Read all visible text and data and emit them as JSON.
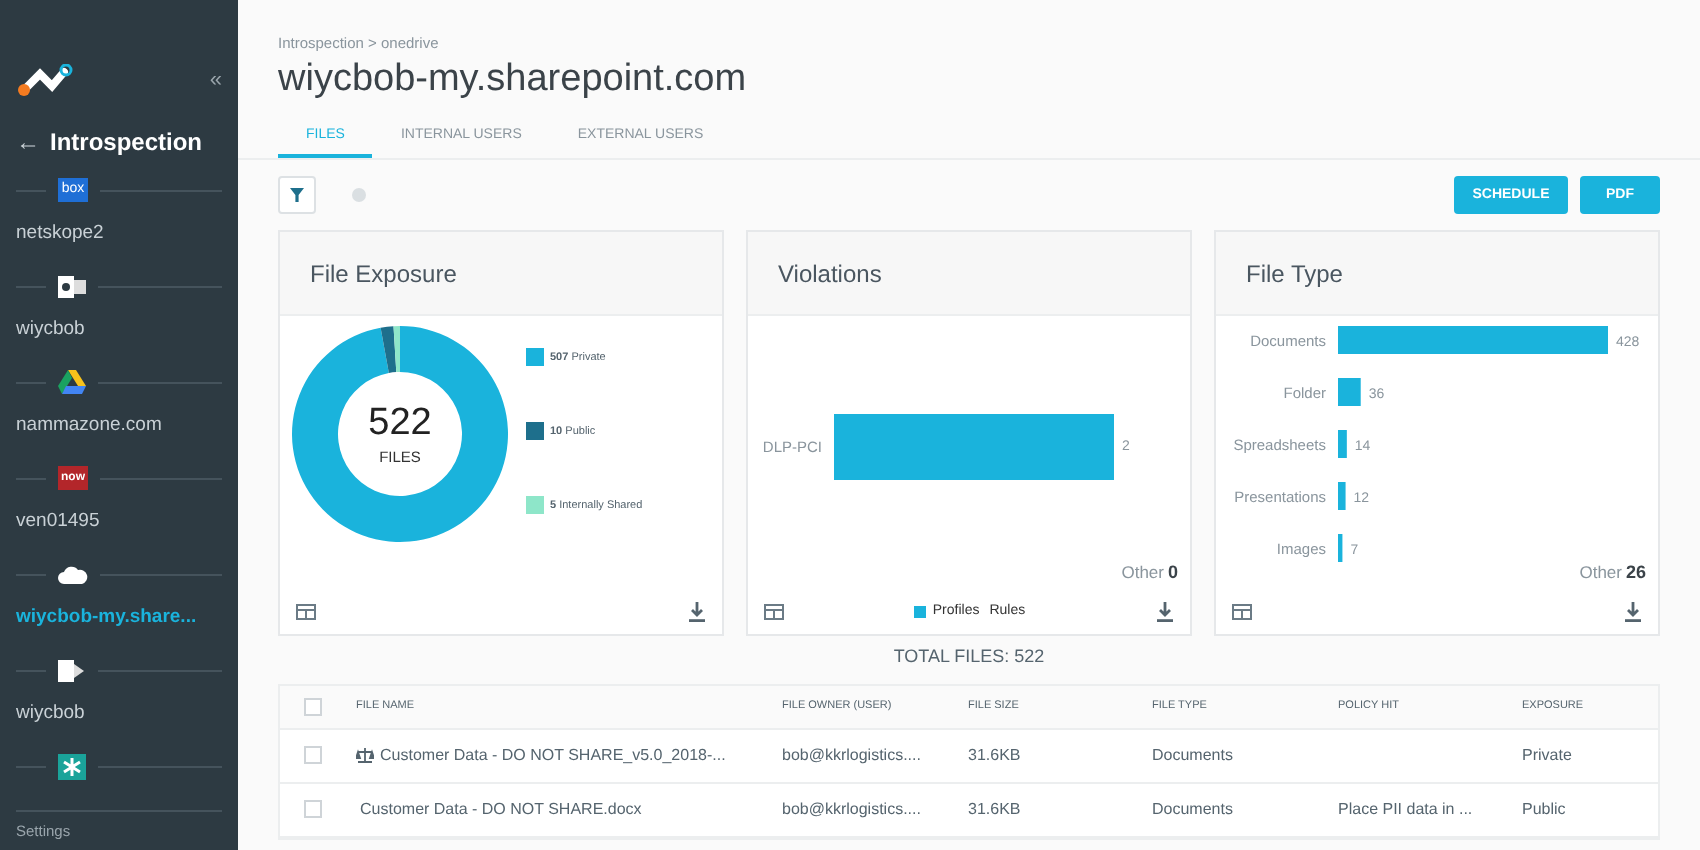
{
  "sidebar": {
    "collapse": "«",
    "back": "←",
    "title": "Introspection",
    "items": [
      {
        "kind": "box",
        "icon_text": "box",
        "label": "netskope2",
        "selected": false
      },
      {
        "kind": "outlook",
        "label": "wiycbob",
        "selected": false
      },
      {
        "kind": "drive",
        "label": "nammazone.com",
        "selected": false
      },
      {
        "kind": "now",
        "icon_text": "now",
        "label": "ven01495",
        "selected": false
      },
      {
        "kind": "cloud",
        "label": "wiycbob-my.share...",
        "selected": true
      },
      {
        "kind": "sharepoint",
        "label": "wiycbob",
        "selected": false
      },
      {
        "kind": "star"
      }
    ],
    "settings": "Settings"
  },
  "breadcrumb": "Introspection > onedrive",
  "title": "wiycbob-my.sharepoint.com",
  "tabs": [
    {
      "label": "FILES",
      "selected": true
    },
    {
      "label": "INTERNAL USERS",
      "selected": false
    },
    {
      "label": "EXTERNAL USERS",
      "selected": false
    }
  ],
  "buttons": [
    "SCHEDULE",
    "PDF"
  ],
  "file_exposure": {
    "title": "File Exposure",
    "center_value": "522",
    "center_label": "FILES",
    "legend": [
      {
        "count": "507",
        "label": "Private",
        "color": "#1ab3dc"
      },
      {
        "count": "10",
        "label": "Public",
        "color": "#1e6f8c"
      },
      {
        "count": "5",
        "label": "Internally Shared",
        "color": "#8ee6c9"
      }
    ]
  },
  "violations": {
    "title": "Violations",
    "other_label": "Other",
    "other_value": "0",
    "bars": [
      {
        "category": "DLP-PCI",
        "value": "2"
      }
    ],
    "legend": [
      {
        "label": "Profiles",
        "selected": true
      },
      {
        "label": "Rules",
        "selected": false
      }
    ]
  },
  "file_type": {
    "title": "File Type",
    "other_label": "Other",
    "other_value": "26",
    "chart_data": {
      "type": "bar",
      "orientation": "horizontal",
      "categories": [
        "Documents",
        "Folder",
        "Spreadsheets",
        "Presentations",
        "Images"
      ],
      "values": [
        428,
        36,
        14,
        12,
        7
      ],
      "data_labels": true
    }
  },
  "total": "TOTAL FILES: 522",
  "table": {
    "select_all_checked": false,
    "columns": [
      "FILE NAME",
      "FILE OWNER (USER)",
      "FILE SIZE",
      "FILE TYPE",
      "POLICY HIT",
      "EXPOSURE"
    ],
    "rows": [
      {
        "checked": false,
        "has_icon": true,
        "cells": [
          "Customer Data - DO NOT SHARE_v5.0_2018-...",
          "bob@kkrlogistics....",
          "31.6KB",
          "Documents",
          "",
          "Private"
        ]
      },
      {
        "checked": false,
        "has_icon": false,
        "cells": [
          "Customer Data - DO NOT SHARE.docx",
          "bob@kkrlogistics....",
          "31.6KB",
          "Documents",
          "Place PII data in ...",
          "Public"
        ]
      }
    ]
  }
}
